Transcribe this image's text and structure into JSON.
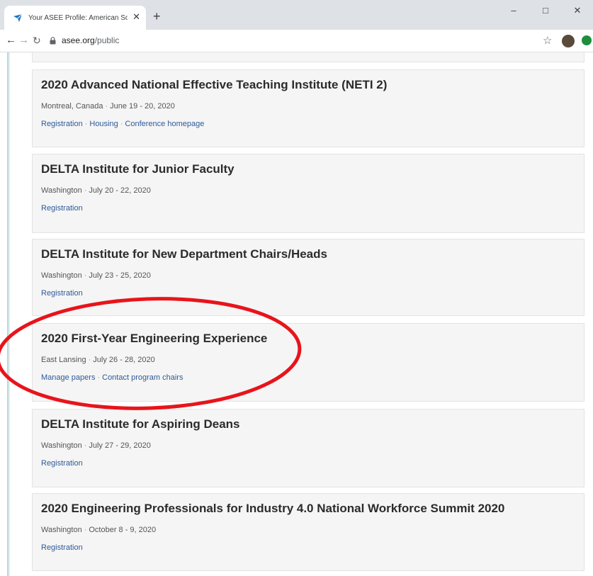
{
  "browser": {
    "tab_title": "Your ASEE Profile: American Society",
    "tab_close": "✕",
    "new_tab": "+",
    "window_controls": {
      "minimize": "–",
      "maximize": "□",
      "close": "✕"
    },
    "url_domain": "asee.org",
    "url_path": "/public",
    "icons": [
      "asee-favicon-icon",
      "back-icon",
      "forward-icon",
      "reload-icon",
      "lock-icon",
      "star-icon",
      "avatar",
      "extension-icon"
    ]
  },
  "events": [
    {
      "title": "2020 Advanced National Effective Teaching Institute (NETI 2)",
      "location": "Montreal, Canada",
      "dates": "June 19 - 20, 2020",
      "links": [
        "Registration",
        "Housing",
        "Conference homepage"
      ]
    },
    {
      "title": "DELTA Institute for Junior Faculty",
      "location": "Washington",
      "dates": "July 20 - 22, 2020",
      "links": [
        "Registration"
      ]
    },
    {
      "title": "DELTA Institute for New Department Chairs/Heads",
      "location": "Washington",
      "dates": "July 23 - 25, 2020",
      "links": [
        "Registration"
      ]
    },
    {
      "title": "2020 First-Year Engineering Experience",
      "location": "East Lansing",
      "dates": "July 26 - 28, 2020",
      "links": [
        "Manage papers",
        "Contact program chairs"
      ]
    },
    {
      "title": "DELTA Institute for Aspiring Deans",
      "location": "Washington",
      "dates": "July 27 - 29, 2020",
      "links": [
        "Registration"
      ]
    },
    {
      "title": "2020 Engineering Professionals for Industry 4.0 National Workforce Summit 2020",
      "location": "Washington",
      "dates": "October 8 - 9, 2020",
      "links": [
        "Registration"
      ]
    }
  ],
  "separator": "·",
  "colors": {
    "annotation": "#e8141b",
    "link": "#2e5a9a",
    "card_bg": "#f5f5f5"
  }
}
